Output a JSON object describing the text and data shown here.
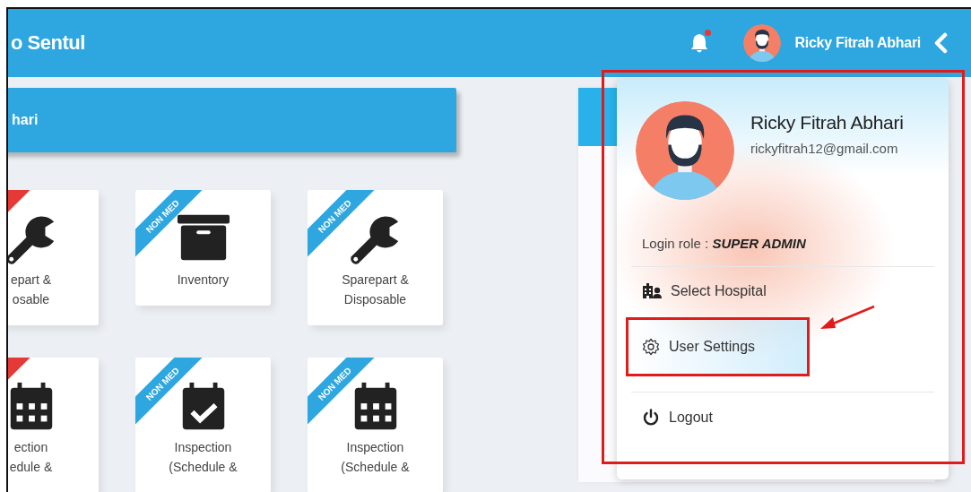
{
  "header": {
    "title": "o Sentul",
    "bell": {
      "unread": true
    },
    "user_name": "Ricky Fitrah Abhari"
  },
  "welcome_bar": {
    "text": "hari"
  },
  "cards": [
    {
      "kind": "wrench",
      "ribbon": {
        "color": "#e53935"
      },
      "lines": [
        "epart &",
        "osable"
      ]
    },
    {
      "kind": "box",
      "ribbon": {
        "text": "NON MED",
        "color": "#2ea6df"
      },
      "lines": [
        "Inventory"
      ]
    },
    {
      "kind": "wrench",
      "ribbon": {
        "text": "NON MED",
        "color": "#2ea6df"
      },
      "lines": [
        "Sparepart &",
        "Disposable"
      ]
    },
    {
      "kind": "calendar",
      "ribbon": {
        "color": "#e53935"
      },
      "lines": [
        "ection",
        "edule &"
      ]
    },
    {
      "kind": "check",
      "ribbon": {
        "text": "NON MED",
        "color": "#2ea6df"
      },
      "lines": [
        "Inspection",
        "(Schedule &"
      ]
    },
    {
      "kind": "calendar",
      "ribbon": {
        "text": "NON MED",
        "color": "#2ea6df"
      },
      "lines": [
        "Inspection",
        "(Schedule &"
      ]
    }
  ],
  "user_menu": {
    "name": "Ricky Fitrah Abhari",
    "email": "rickyfitrah12@gmail.com",
    "role": "Login role : **SUPER ADMIN**",
    "items": [
      {
        "kind": "hospital",
        "label": "Select Hospital",
        "divider_before": false,
        "annotated": false
      },
      {
        "kind": "settings",
        "label": "User Settings",
        "divider_before": false,
        "annotated": true
      },
      {
        "kind": "logout",
        "label": "Logout",
        "divider_before": true,
        "annotated": false
      }
    ],
    "annotated": true
  }
}
